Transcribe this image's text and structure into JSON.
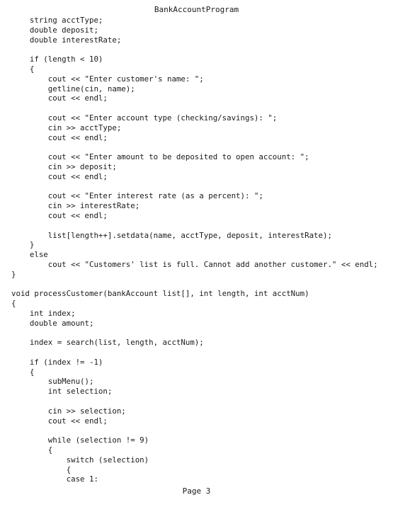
{
  "document": {
    "header_title": "BankAccountProgram",
    "page_label": "Page 3",
    "code_lines": [
      "    string acctType;",
      "    double deposit;",
      "    double interestRate;",
      "",
      "    if (length < 10)",
      "    {",
      "        cout << \"Enter customer's name: \";",
      "        getline(cin, name);",
      "        cout << endl;",
      "",
      "        cout << \"Enter account type (checking/savings): \";",
      "        cin >> acctType;",
      "        cout << endl;",
      "",
      "        cout << \"Enter amount to be deposited to open account: \";",
      "        cin >> deposit;",
      "        cout << endl;",
      "",
      "        cout << \"Enter interest rate (as a percent): \";",
      "        cin >> interestRate;",
      "        cout << endl;",
      "",
      "        list[length++].setdata(name, acctType, deposit, interestRate);",
      "    }",
      "    else",
      "        cout << \"Customers' list is full. Cannot add another customer.\" << endl;",
      "}",
      "",
      "void processCustomer(bankAccount list[], int length, int acctNum)",
      "{",
      "    int index;",
      "    double amount;",
      "",
      "    index = search(list, length, acctNum);",
      "",
      "    if (index != -1)",
      "    {",
      "        subMenu();",
      "        int selection;",
      "",
      "        cin >> selection;",
      "        cout << endl;",
      "",
      "        while (selection != 9)",
      "        {",
      "            switch (selection)",
      "            {",
      "            case 1:"
    ]
  }
}
